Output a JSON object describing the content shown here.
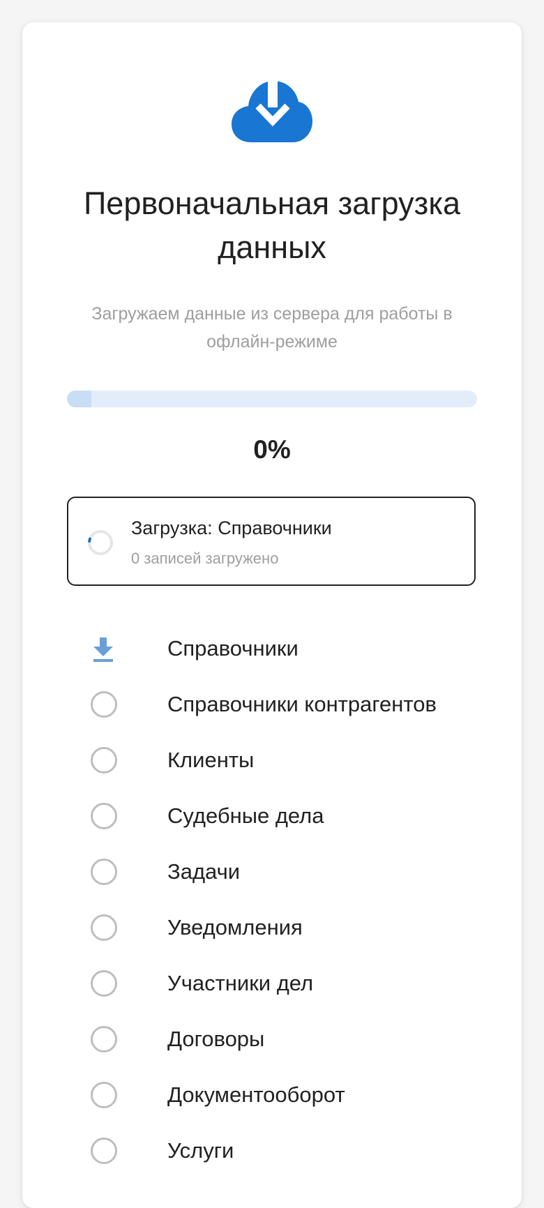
{
  "header": {
    "icon": "cloud-download-icon",
    "title": "Первоначальная загрузка данных",
    "subtitle": "Загружаем данные из сервера для работы в офлайн-режиме"
  },
  "progress": {
    "fraction": 0.06,
    "percent_label": "0%"
  },
  "current": {
    "title": "Загрузка: Справочники",
    "subtitle": "0 записей загружено"
  },
  "steps": [
    {
      "label": "Справочники",
      "state": "active",
      "icon": "download-icon"
    },
    {
      "label": "Справочники контрагентов",
      "state": "pending",
      "icon": "empty-circle-icon"
    },
    {
      "label": "Клиенты",
      "state": "pending",
      "icon": "empty-circle-icon"
    },
    {
      "label": "Судебные дела",
      "state": "pending",
      "icon": "empty-circle-icon"
    },
    {
      "label": "Задачи",
      "state": "pending",
      "icon": "empty-circle-icon"
    },
    {
      "label": "Уведомления",
      "state": "pending",
      "icon": "empty-circle-icon"
    },
    {
      "label": "Участники дел",
      "state": "pending",
      "icon": "empty-circle-icon"
    },
    {
      "label": "Договоры",
      "state": "pending",
      "icon": "empty-circle-icon"
    },
    {
      "label": "Документооборот",
      "state": "pending",
      "icon": "empty-circle-icon"
    },
    {
      "label": "Услуги",
      "state": "pending",
      "icon": "empty-circle-icon"
    }
  ],
  "colors": {
    "accent": "#1976d2",
    "track": "#e3edfa",
    "muted": "#9e9e9e",
    "pending_circle": "#bdbdbd"
  }
}
